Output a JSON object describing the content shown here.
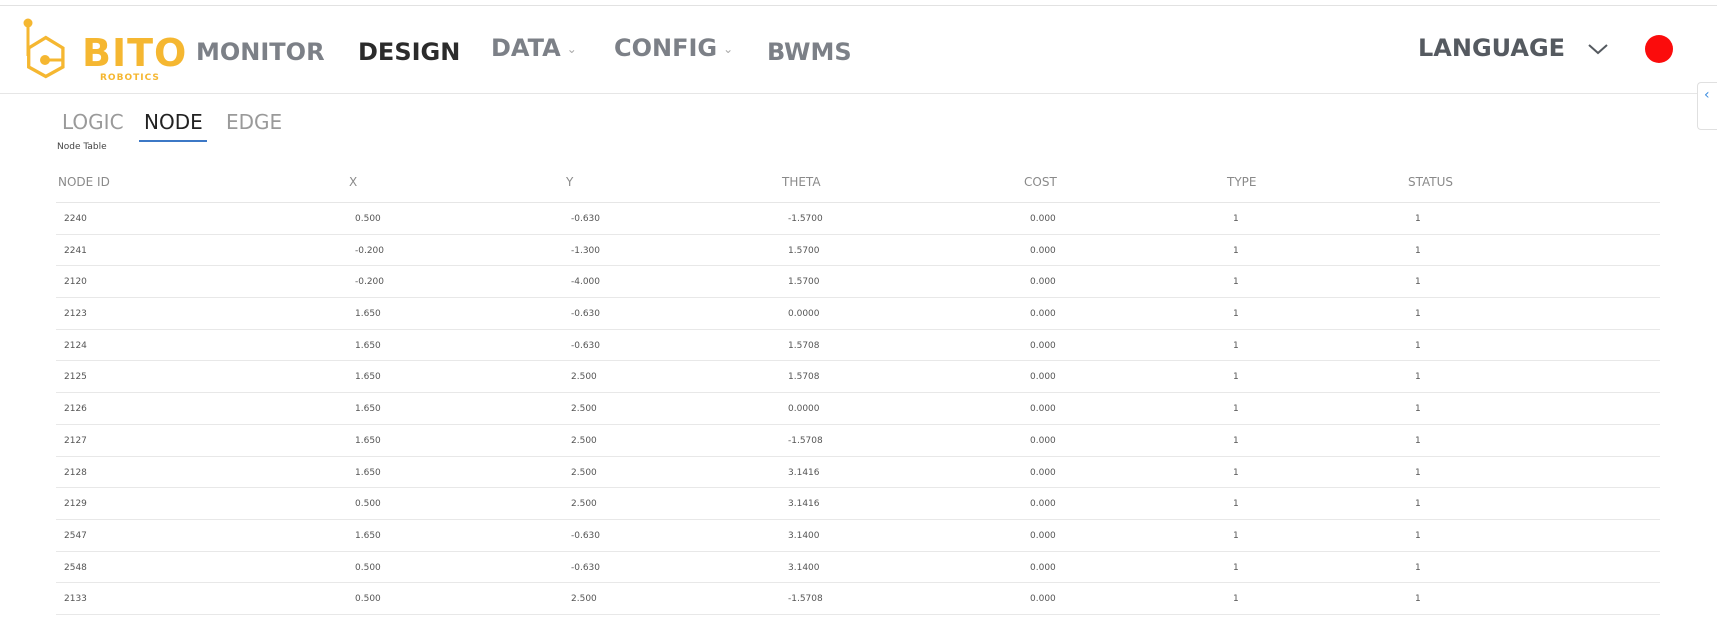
{
  "brand": {
    "name": "BITO",
    "sub": "ROBOTICS",
    "color": "#f5b731"
  },
  "nav": {
    "items": [
      {
        "label": "MONITOR",
        "active": false
      },
      {
        "label": "DESIGN",
        "active": true
      },
      {
        "label": "DATA",
        "dropdown": true
      },
      {
        "label": "CONFIG",
        "dropdown": true
      },
      {
        "label": "BWMS",
        "active": false
      }
    ],
    "language_label": "LANGUAGE",
    "status_color": "#fb0c0c"
  },
  "tabs": [
    {
      "label": "LOGIC",
      "active": false
    },
    {
      "label": "NODE",
      "active": true
    },
    {
      "label": "EDGE",
      "active": false
    }
  ],
  "table": {
    "caption": "Node Table",
    "columns": [
      "NODE ID",
      "X",
      "Y",
      "THETA",
      "COST",
      "TYPE",
      "STATUS"
    ],
    "rows": [
      [
        "2240",
        "0.500",
        "-0.630",
        "-1.5700",
        "0.000",
        "1",
        "1"
      ],
      [
        "2241",
        "-0.200",
        "-1.300",
        "1.5700",
        "0.000",
        "1",
        "1"
      ],
      [
        "2120",
        "-0.200",
        "-4.000",
        "1.5700",
        "0.000",
        "1",
        "1"
      ],
      [
        "2123",
        "1.650",
        "-0.630",
        "0.0000",
        "0.000",
        "1",
        "1"
      ],
      [
        "2124",
        "1.650",
        "-0.630",
        "1.5708",
        "0.000",
        "1",
        "1"
      ],
      [
        "2125",
        "1.650",
        "2.500",
        "1.5708",
        "0.000",
        "1",
        "1"
      ],
      [
        "2126",
        "1.650",
        "2.500",
        "0.0000",
        "0.000",
        "1",
        "1"
      ],
      [
        "2127",
        "1.650",
        "2.500",
        "-1.5708",
        "0.000",
        "1",
        "1"
      ],
      [
        "2128",
        "1.650",
        "2.500",
        "3.1416",
        "0.000",
        "1",
        "1"
      ],
      [
        "2129",
        "0.500",
        "2.500",
        "3.1416",
        "0.000",
        "1",
        "1"
      ],
      [
        "2547",
        "1.650",
        "-0.630",
        "3.1400",
        "0.000",
        "1",
        "1"
      ],
      [
        "2548",
        "0.500",
        "-0.630",
        "3.1400",
        "0.000",
        "1",
        "1"
      ],
      [
        "2133",
        "0.500",
        "2.500",
        "-1.5708",
        "0.000",
        "1",
        "1"
      ]
    ]
  }
}
